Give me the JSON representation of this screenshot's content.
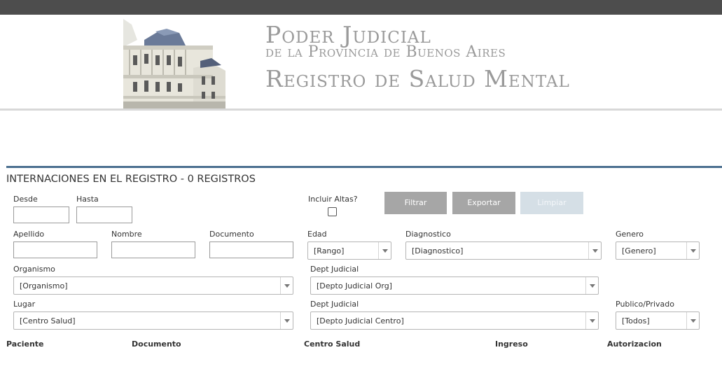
{
  "banner": {
    "line1": "Poder Judicial",
    "line2": "de la Provincia de Buenos Aires",
    "line3": "Registro de Salud Mental"
  },
  "section_title": "INTERNACIONES EN EL REGISTRO - 0 REGISTROS",
  "filters": {
    "desde_label": "Desde",
    "hasta_label": "Hasta",
    "incluir_altas_label": "Incluir Altas?",
    "apellido_label": "Apellido",
    "nombre_label": "Nombre",
    "documento_label": "Documento",
    "edad_label": "Edad",
    "edad_value": "[Rango]",
    "diagnostico_label": "Diagnostico",
    "diagnostico_value": "[Diagnostico]",
    "genero_label": "Genero",
    "genero_value": "[Genero]",
    "organismo_label": "Organismo",
    "organismo_value": "[Organismo]",
    "dept_org_label": "Dept Judicial",
    "dept_org_value": "[Depto Judicial Org]",
    "lugar_label": "Lugar",
    "lugar_value": "[Centro Salud]",
    "dept_centro_label": "Dept Judicial",
    "dept_centro_value": "[Depto Judicial Centro]",
    "publico_label": "Publico/Privado",
    "publico_value": "[Todos]"
  },
  "buttons": {
    "filtrar": "Filtrar",
    "exportar": "Exportar",
    "limpiar": "Limpiar"
  },
  "table": {
    "columns": [
      "Paciente",
      "Documento",
      "Centro Salud",
      "Ingreso",
      "Autorizacion"
    ]
  }
}
